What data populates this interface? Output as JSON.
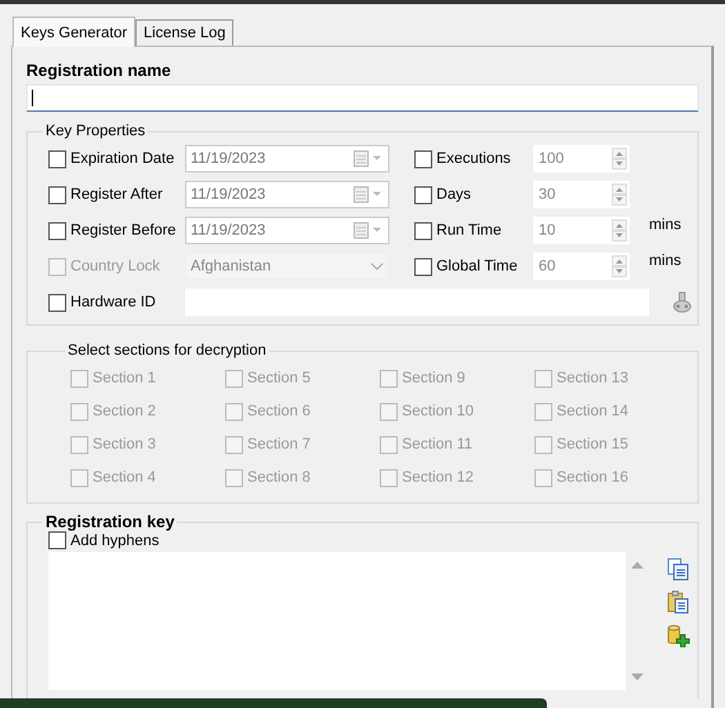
{
  "tabs": [
    {
      "label": "Keys Generator",
      "selected": true
    },
    {
      "label": "License Log",
      "selected": false
    }
  ],
  "registration_name": {
    "label": "Registration name"
  },
  "key_properties": {
    "title": "Key Properties",
    "left": [
      {
        "label": "Expiration Date",
        "checked": false,
        "disabled": false,
        "kind": "date",
        "value": "11/19/2023"
      },
      {
        "label": "Register After",
        "checked": false,
        "disabled": false,
        "kind": "date",
        "value": "11/19/2023"
      },
      {
        "label": "Register Before",
        "checked": false,
        "disabled": false,
        "kind": "date",
        "value": "11/19/2023"
      },
      {
        "label": "Country Lock",
        "checked": false,
        "disabled": true,
        "kind": "dropdown",
        "value": "Afghanistan"
      }
    ],
    "right": [
      {
        "label": "Executions",
        "checked": false,
        "value": "100"
      },
      {
        "label": "Days",
        "checked": false,
        "value": "30"
      },
      {
        "label": "Run Time",
        "checked": false,
        "value": "10",
        "unit": "mins"
      },
      {
        "label": "Global Time",
        "checked": false,
        "value": "60",
        "unit": "mins"
      }
    ],
    "hardware_id": {
      "label": "Hardware ID",
      "checked": false
    }
  },
  "sections": {
    "title": "Select sections for decryption",
    "items": [
      {
        "label": "Section 1",
        "checked": false,
        "disabled": true
      },
      {
        "label": "Section 2",
        "checked": false,
        "disabled": true
      },
      {
        "label": "Section 3",
        "checked": false,
        "disabled": true
      },
      {
        "label": "Section 4",
        "checked": false,
        "disabled": true
      },
      {
        "label": "Section 5",
        "checked": false,
        "disabled": true
      },
      {
        "label": "Section 6",
        "checked": false,
        "disabled": true
      },
      {
        "label": "Section 7",
        "checked": false,
        "disabled": true
      },
      {
        "label": "Section 8",
        "checked": false,
        "disabled": true
      },
      {
        "label": "Section 9",
        "checked": false,
        "disabled": true
      },
      {
        "label": "Section 10",
        "checked": false,
        "disabled": true
      },
      {
        "label": "Section 11",
        "checked": false,
        "disabled": true
      },
      {
        "label": "Section 12",
        "checked": false,
        "disabled": true
      },
      {
        "label": "Section 13",
        "checked": false,
        "disabled": true
      },
      {
        "label": "Section 14",
        "checked": false,
        "disabled": true
      },
      {
        "label": "Section 15",
        "checked": false,
        "disabled": true
      },
      {
        "label": "Section 16",
        "checked": false,
        "disabled": true
      }
    ]
  },
  "registration_key": {
    "title": "Registration key",
    "add_hyphens": {
      "label": "Add hyphens",
      "checked": false
    }
  }
}
